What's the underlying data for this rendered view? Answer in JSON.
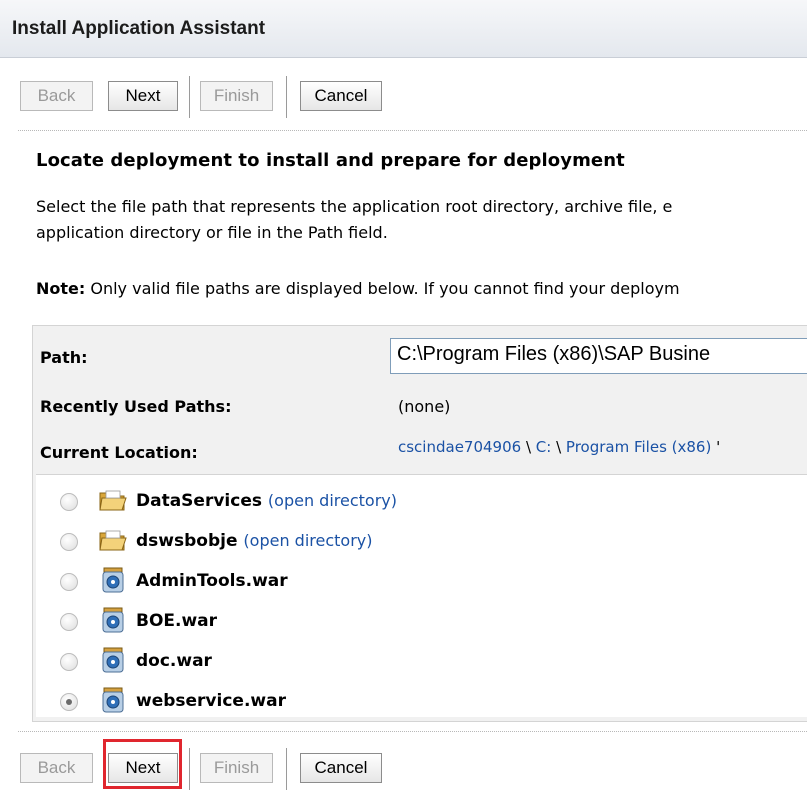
{
  "window": {
    "title": "Install Application Assistant"
  },
  "toolbar": {
    "back": "Back",
    "next": "Next",
    "finish": "Finish",
    "cancel": "Cancel"
  },
  "section": {
    "heading": "Locate deployment to install and prepare for deployment",
    "description_line1": "Select the file path that represents the application root directory, archive file, e",
    "description_line2": "application directory or file in the Path field.",
    "note_label": "Note:",
    "note_text": " Only valid file paths are displayed below. If you cannot find your deploym"
  },
  "form": {
    "path_label": "Path:",
    "path_value": "C:\\Program Files (x86)\\SAP Busine",
    "recent_label": "Recently Used Paths:",
    "recent_value": "(none)",
    "location_label": "Current Location:",
    "location": {
      "crumb1": "cscindae704906",
      "sep1": " \\ ",
      "crumb2": "C:",
      "sep2": " \\ ",
      "crumb3": "Program Files (x86)",
      "sep3": " '"
    }
  },
  "files": [
    {
      "name": "DataServices",
      "action": "(open directory)",
      "icon": "folder-icon",
      "selected": false
    },
    {
      "name": "dswsbobje",
      "action": "(open directory)",
      "icon": "folder-icon",
      "selected": false
    },
    {
      "name": "AdminTools.war",
      "action": "",
      "icon": "war-archive-icon",
      "selected": false
    },
    {
      "name": "BOE.war",
      "action": "",
      "icon": "war-archive-icon",
      "selected": false
    },
    {
      "name": "doc.war",
      "action": "",
      "icon": "war-archive-icon",
      "selected": false
    },
    {
      "name": "webservice.war",
      "action": "",
      "icon": "war-archive-icon",
      "selected": true
    }
  ],
  "colors": {
    "highlight": "#e0262e",
    "link": "#1b52a5"
  }
}
